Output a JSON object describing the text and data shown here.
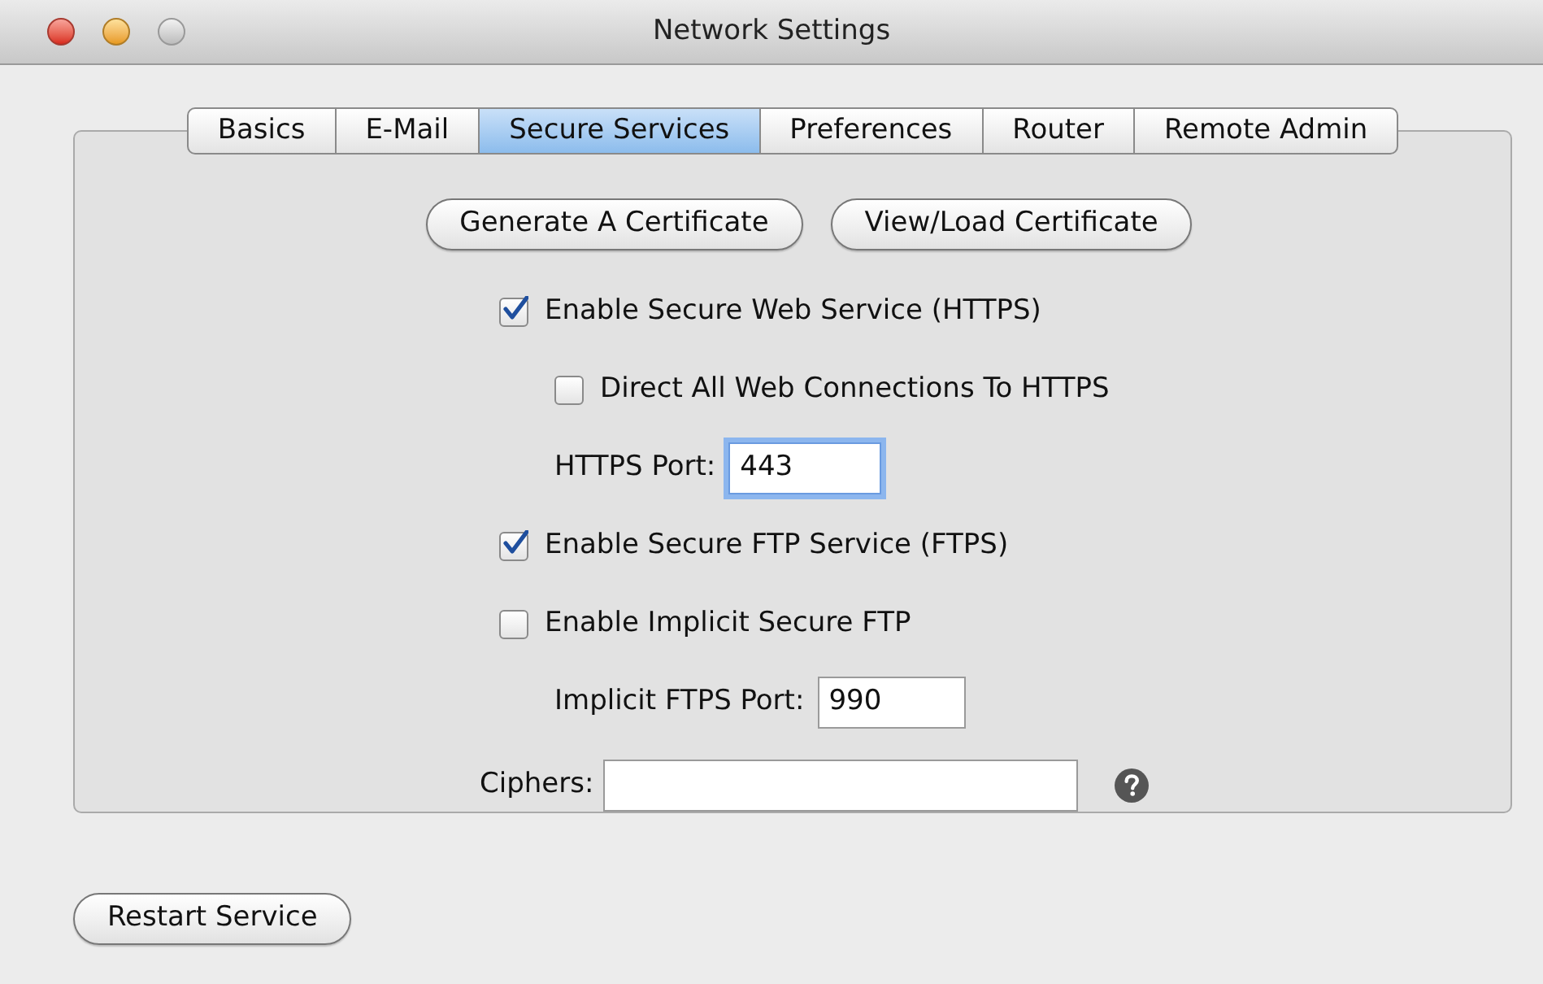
{
  "window": {
    "title": "Network Settings"
  },
  "tabs": [
    {
      "label": "Basics",
      "selected": false
    },
    {
      "label": "E-Mail",
      "selected": false
    },
    {
      "label": "Secure Services",
      "selected": true
    },
    {
      "label": "Preferences",
      "selected": false
    },
    {
      "label": "Router",
      "selected": false
    },
    {
      "label": "Remote Admin",
      "selected": false
    }
  ],
  "buttons": [
    {
      "label": "Generate A Certificate"
    },
    {
      "label": "View/Load Certificate"
    }
  ],
  "options": [
    {
      "kind": "checkbox",
      "label": "Enable Secure Web Service (HTTPS)",
      "checked": true,
      "children": [
        {
          "kind": "checkbox",
          "label": "Direct All Web Connections To HTTPS",
          "checked": false
        },
        {
          "kind": "field",
          "label": "HTTPS Port:",
          "value": "443",
          "focused": true
        }
      ]
    },
    {
      "kind": "checkbox",
      "label": "Enable Secure FTP Service (FTPS)",
      "checked": true
    },
    {
      "kind": "checkbox",
      "label": "Enable Implicit Secure FTP",
      "checked": false,
      "children": [
        {
          "kind": "field",
          "label": "Implicit FTPS Port:",
          "value": "990",
          "focused": false
        }
      ]
    }
  ],
  "ciphers": {
    "label": "Ciphers:"
  },
  "footer_button": {
    "label": "Restart Service"
  }
}
